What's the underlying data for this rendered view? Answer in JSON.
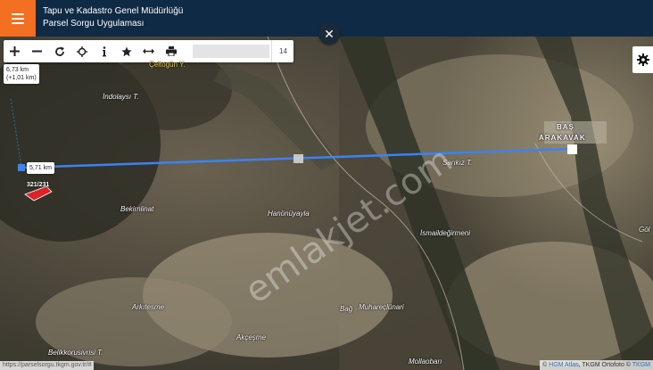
{
  "header": {
    "title_line1": "Tapu ve Kadastro Genel Müdürlüğü",
    "title_line2": "Parsel Sorgu Uygulaması"
  },
  "toolbar": {
    "tools": [
      "plus-icon",
      "minus-icon",
      "refresh-icon",
      "locate-icon",
      "info-icon",
      "star-icon",
      "measure-icon",
      "print-icon"
    ],
    "zoom_level": "14"
  },
  "measurements": {
    "total": "6,73 km",
    "delta": "(+1,01 km)",
    "segment": "5,71 km"
  },
  "parcel": {
    "label": "321/231"
  },
  "places": {
    "celtogun": "Çeltogün Y.",
    "indolaysi": "İndolaysı T.",
    "bas": "BAŞ",
    "arakavak": "ARAKAVAK",
    "sarikiz": "Sarıkız T.",
    "hanonuyayla": "Hanönüyayla",
    "ismaildegirmeni": "İsmaildeğirmeni",
    "gol": "Göl",
    "arkitesme": "Arkıtesme",
    "bag": "Bağ",
    "muharocdunari": "Muhareçlünari",
    "akcesme": "Akçeşme",
    "belikkorusivrisi": "Belikkorusivrisi T.",
    "mollaoba": "Mollaobarı",
    "bekimsa": "Bekirnlinat"
  },
  "watermark": "emlakjet.com",
  "footer": {
    "url": "https://parselsorgu.tkgm.gov.tr/#",
    "attr_prefix": "© ",
    "attr_hgm": "HGM Atlas",
    "attr_middle": ", TKGM Ortofoto © ",
    "attr_tkgm": "TKGM"
  },
  "colors": {
    "header_bg": "#0f2a44",
    "menu_accent": "#f36f21",
    "measure_line": "#3b82f6",
    "parcel": "#d8232a"
  }
}
